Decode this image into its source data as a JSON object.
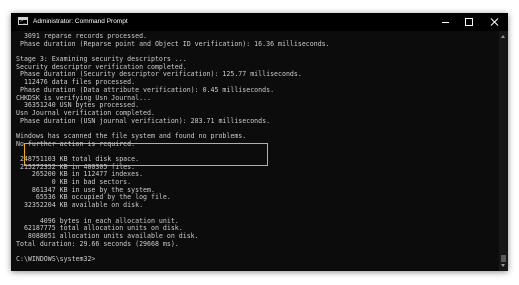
{
  "window": {
    "title": "Administrator: Command Prompt",
    "icon": "console-icon"
  },
  "colors": {
    "console_bg": "#0c0c0c",
    "console_text": "#cccccc",
    "highlight_border": "#f2a91e"
  },
  "console": {
    "lines": [
      "  3091 reparse records processed.",
      " Phase duration (Reparse point and Object ID verification): 16.36 milliseconds.",
      "",
      "Stage 3: Examining security descriptors ...",
      "Security descriptor verification completed.",
      " Phase duration (Security descriptor verification): 125.77 milliseconds.",
      "  112476 data files processed.",
      " Phase duration (Data attribute verification): 0.45 milliseconds.",
      "CHKDSK is verifying Usn Journal...",
      "  36351240 USN bytes processed.",
      "Usn Journal verification completed.",
      " Phase duration (USN journal verification): 283.71 milliseconds.",
      "",
      "Windows has scanned the file system and found no problems.",
      "No further action is required.",
      "",
      " 248751103 KB total disk space.",
      " 215272352 KB in 400305 files.",
      "    265200 KB in 112477 indexes.",
      "         0 KB in bad sectors.",
      "    861347 KB in use by the system.",
      "     65536 KB occupied by the log file.",
      "  32352204 KB available on disk.",
      "",
      "      4096 bytes in each allocation unit.",
      "  62187775 total allocation units on disk.",
      "   8088051 allocation units available on disk.",
      "Total duration: 29.66 seconds (29668 ms).",
      "",
      "C:\\WINDOWS\\system32>"
    ]
  }
}
